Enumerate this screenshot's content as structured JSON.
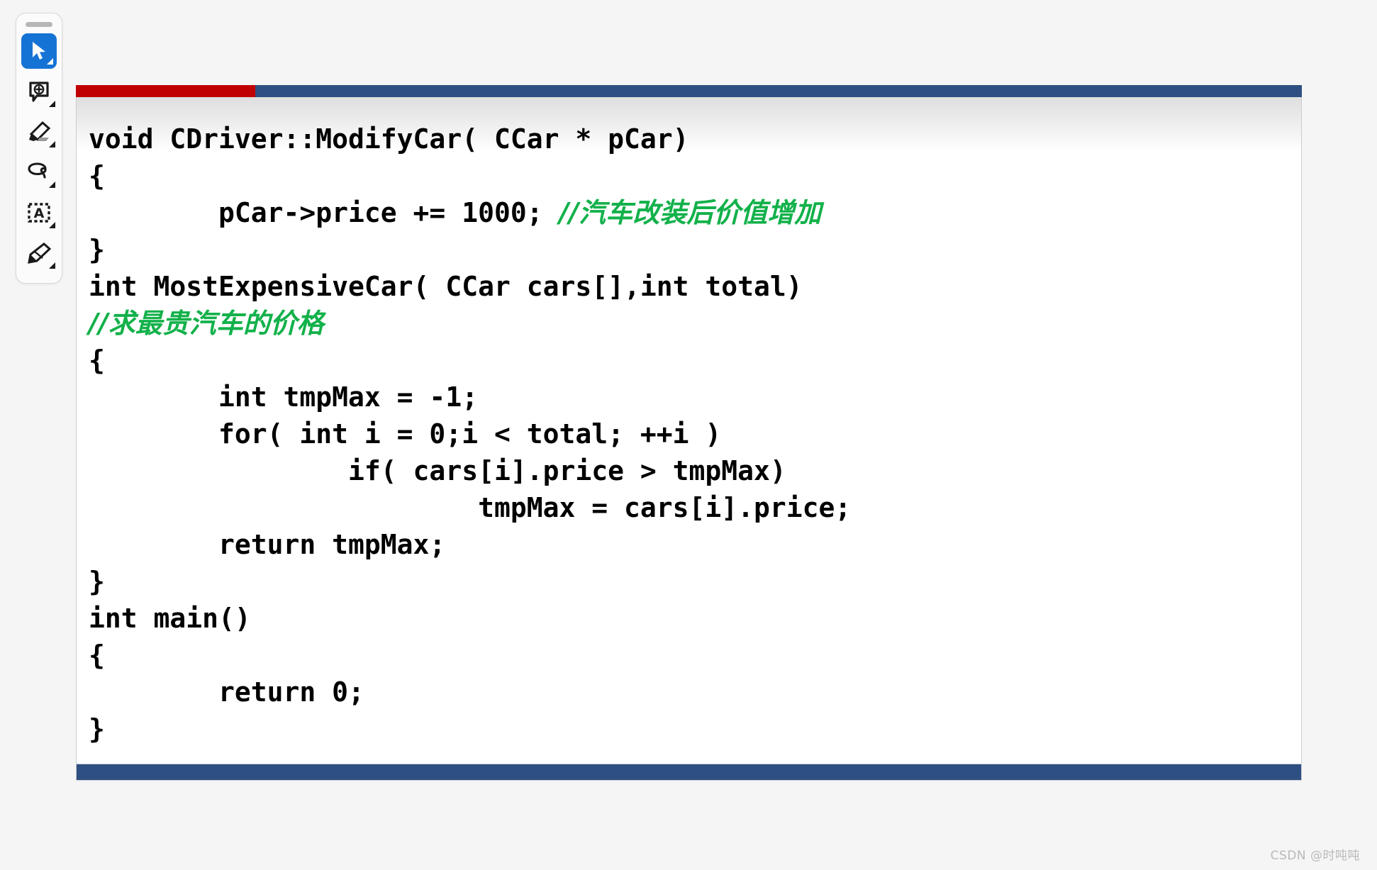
{
  "toolbar": {
    "name": "annotation-toolbar",
    "drag_handle_label": "drag-handle",
    "tools": [
      {
        "id": "select",
        "icon": "cursor-arrow-icon",
        "label": "Select",
        "active": true,
        "has_caret": true
      },
      {
        "id": "add-comment",
        "icon": "comment-plus-icon",
        "label": "Add comment",
        "active": false,
        "has_caret": true
      },
      {
        "id": "highlighter",
        "icon": "highlighter-pen-icon",
        "label": "Highlight",
        "active": false,
        "has_caret": true
      },
      {
        "id": "lasso",
        "icon": "lasso-icon",
        "label": "Lasso select",
        "active": false,
        "has_caret": true
      },
      {
        "id": "text-select",
        "icon": "text-box-a-icon",
        "label": "Text select",
        "active": false,
        "has_caret": true
      },
      {
        "id": "signature-pen",
        "icon": "fountain-pen-icon",
        "label": "Sign / draw",
        "active": false,
        "has_caret": true
      }
    ]
  },
  "slide": {
    "accent_red": "#C00000",
    "accent_blue": "#2E4F82",
    "comment_green": "#12B14A",
    "code_lines": [
      {
        "indent": 0,
        "code": "void CDriver::ModifyCar( CCar * pCar)",
        "comment": ""
      },
      {
        "indent": 0,
        "code": "{",
        "comment": ""
      },
      {
        "indent": 1,
        "code": "pCar->price += 1000; ",
        "comment": "//汽车改装后价值增加"
      },
      {
        "indent": 0,
        "code": "}",
        "comment": ""
      },
      {
        "indent": 0,
        "code": "int MostExpensiveCar( CCar cars[],int total)",
        "comment": ""
      },
      {
        "indent": 0,
        "code": "",
        "comment": "//求最贵汽车的价格"
      },
      {
        "indent": 0,
        "code": "{",
        "comment": ""
      },
      {
        "indent": 1,
        "code": "int tmpMax = -1;",
        "comment": ""
      },
      {
        "indent": 1,
        "code": "for( int i = 0;i < total; ++i )",
        "comment": ""
      },
      {
        "indent": 2,
        "code": "if( cars[i].price > tmpMax)",
        "comment": ""
      },
      {
        "indent": 3,
        "code": "tmpMax = cars[i].price;",
        "comment": ""
      },
      {
        "indent": 1,
        "code": "return tmpMax;",
        "comment": ""
      },
      {
        "indent": 0,
        "code": "}",
        "comment": ""
      },
      {
        "indent": 0,
        "code": "int main()",
        "comment": ""
      },
      {
        "indent": 0,
        "code": "{",
        "comment": ""
      },
      {
        "indent": 1,
        "code": "return 0;",
        "comment": ""
      },
      {
        "indent": 0,
        "code": "}",
        "comment": ""
      }
    ]
  },
  "watermark": {
    "text": "CSDN @时吨吨"
  }
}
